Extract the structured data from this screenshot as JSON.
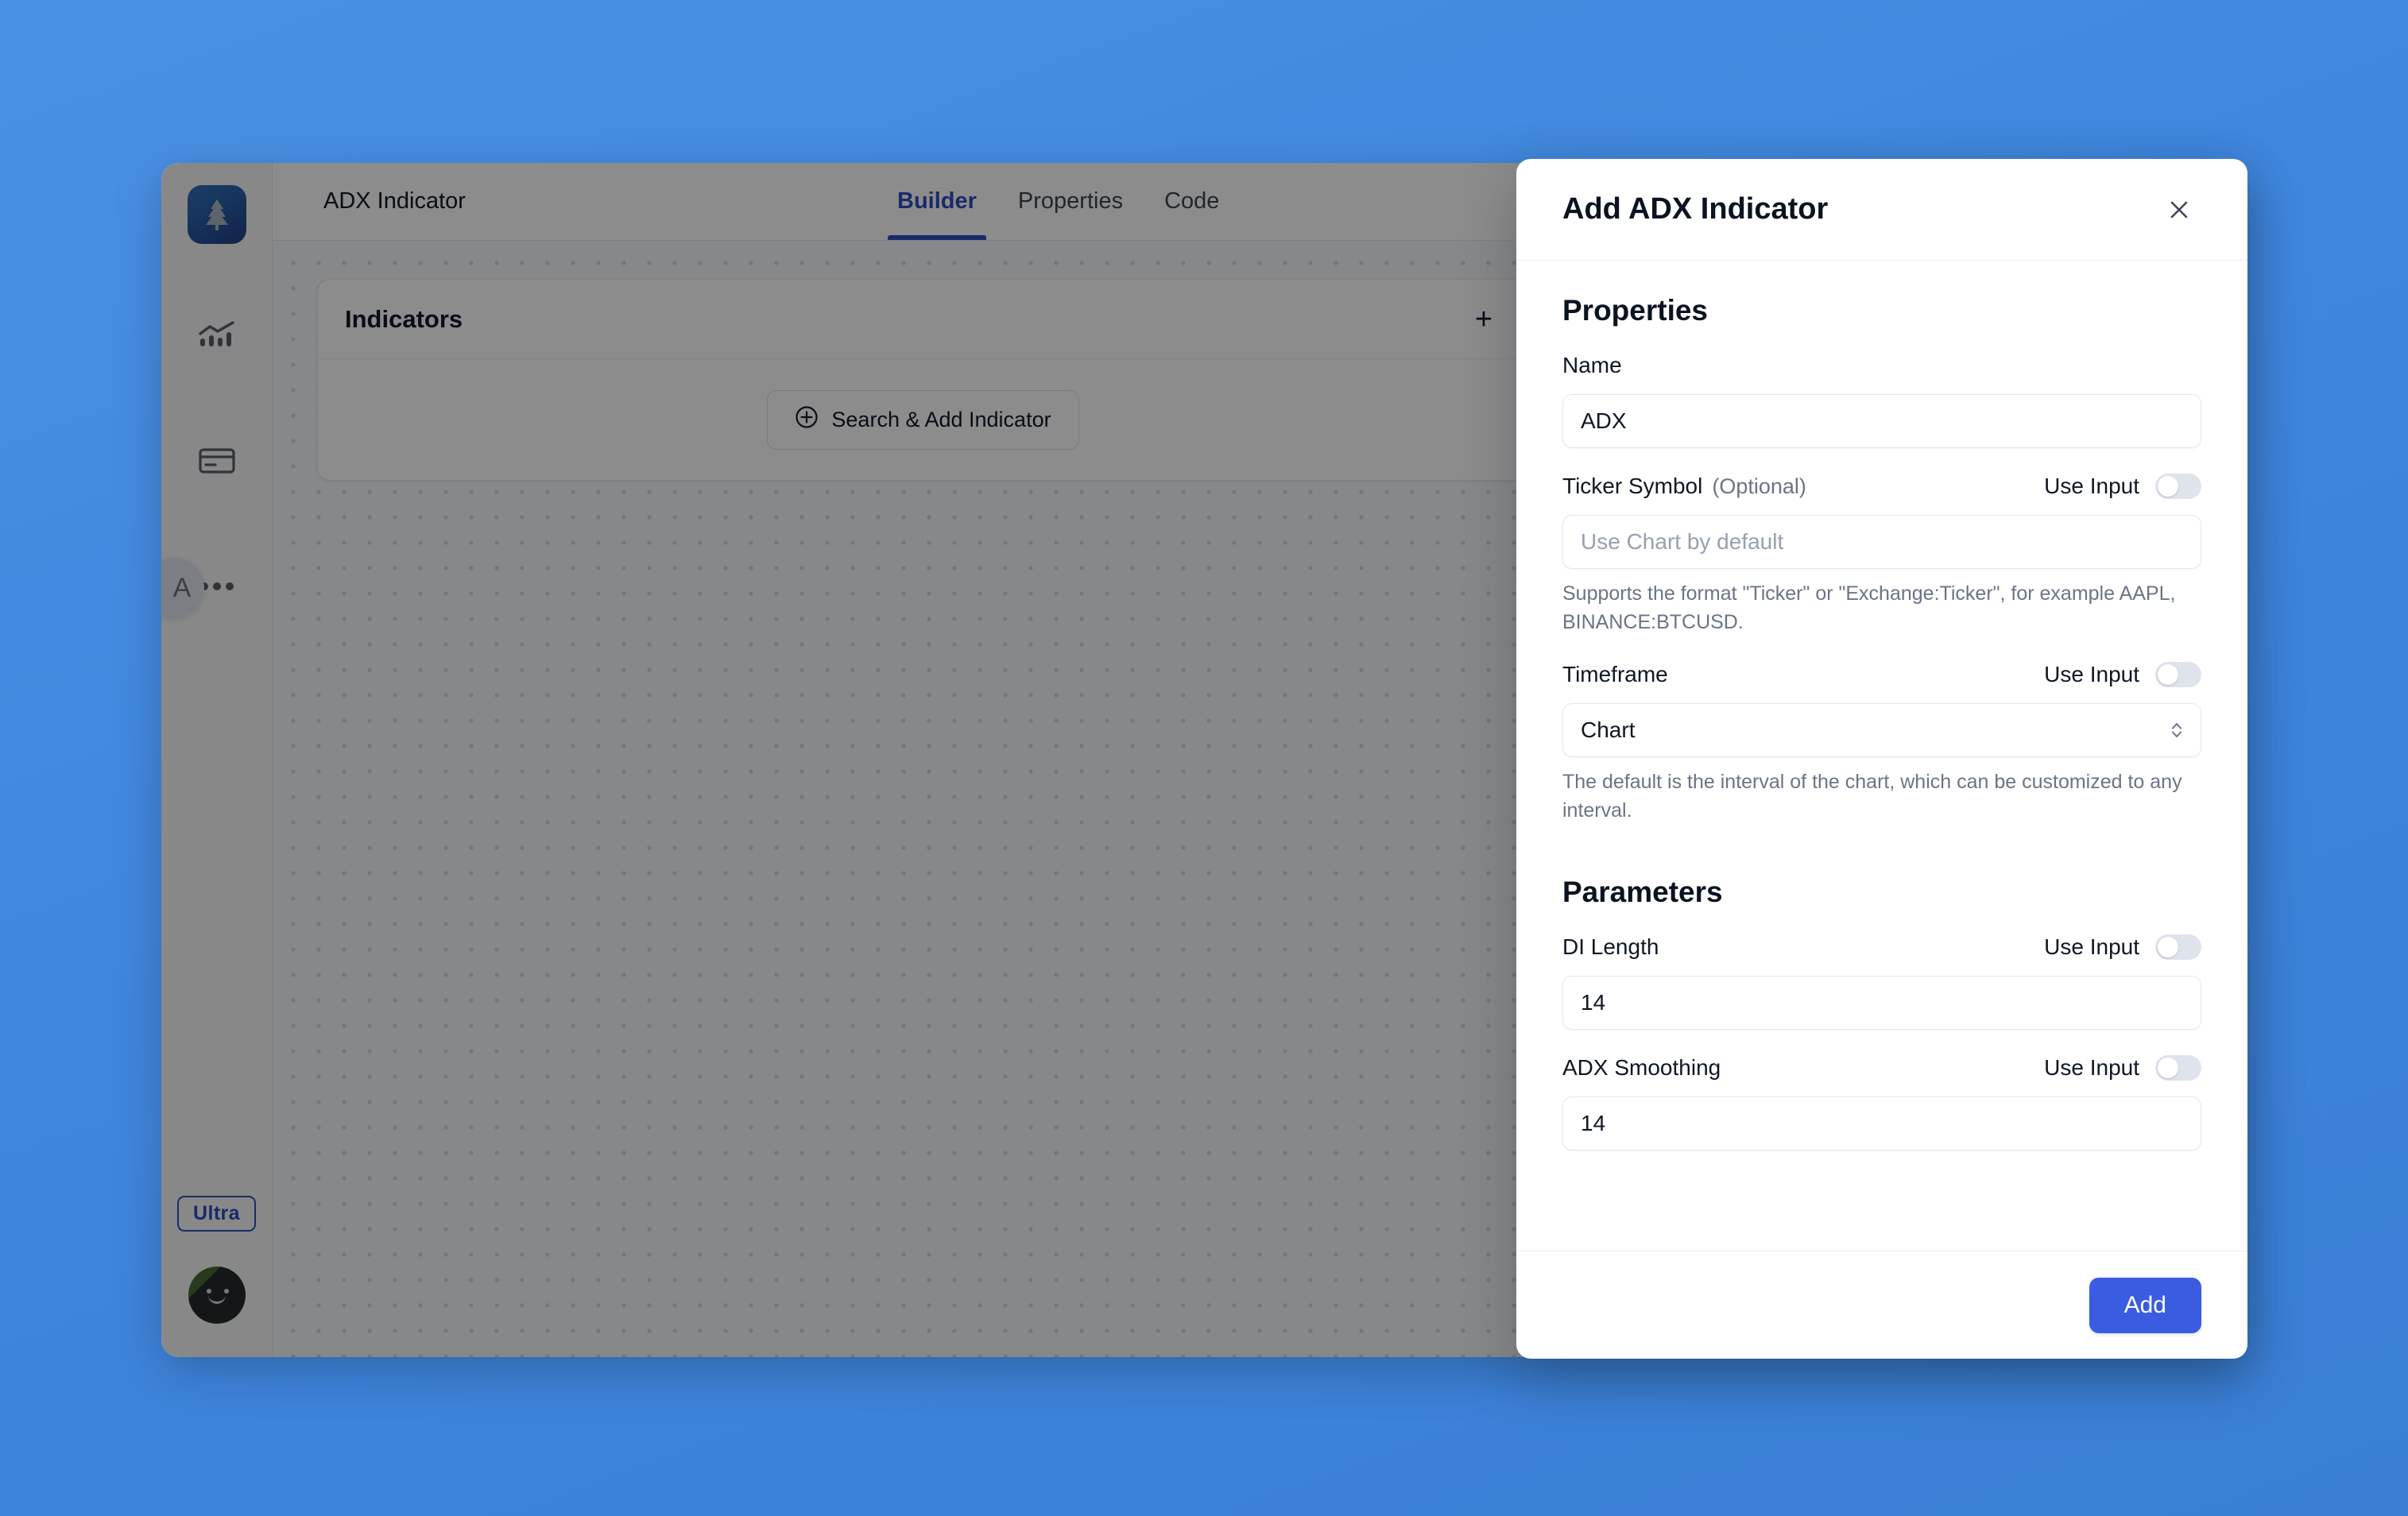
{
  "app": {
    "document_title": "ADX Indicator",
    "tabs": [
      {
        "label": "Builder",
        "active": true
      },
      {
        "label": "Properties",
        "active": false
      },
      {
        "label": "Code",
        "active": false
      }
    ],
    "rail": {
      "logo_icon": "pine-tree-logo-icon",
      "items": [
        {
          "icon": "chart-bars-icon"
        },
        {
          "icon": "credit-card-icon"
        },
        {
          "icon": "ellipsis-icon"
        }
      ],
      "plan_badge": "Ultra",
      "avatar_label": "",
      "side_badge_letter": "A"
    },
    "indicators_card": {
      "title": "Indicators",
      "add_icon": "+",
      "empty_button": "Search & Add Indicator",
      "empty_button_icon": "plus-circle-icon"
    }
  },
  "modal": {
    "title": "Add ADX Indicator",
    "close_icon": "close-icon",
    "sections": {
      "properties_title": "Properties",
      "parameters_title": "Parameters"
    },
    "fields": {
      "name": {
        "label": "Name",
        "value": "ADX",
        "placeholder": ""
      },
      "ticker_symbol": {
        "label": "Ticker Symbol",
        "optional": "(Optional)",
        "use_input_label": "Use Input",
        "use_input_state": "off",
        "value": "",
        "placeholder": "Use Chart by default",
        "hint": "Supports the format \"Ticker\" or \"Exchange:Ticker\", for example AAPL, BINANCE:BTCUSD."
      },
      "timeframe": {
        "label": "Timeframe",
        "use_input_label": "Use Input",
        "use_input_state": "off",
        "selected": "Chart",
        "hint": "The default is the interval of the chart, which can be customized to any interval."
      },
      "di_length": {
        "label": "DI Length",
        "use_input_label": "Use Input",
        "use_input_state": "off",
        "value": "14"
      },
      "adx_smoothing": {
        "label": "ADX Smoothing",
        "use_input_label": "Use Input",
        "use_input_state": "off",
        "value": "14"
      }
    },
    "footer": {
      "add_label": "Add"
    }
  },
  "colors": {
    "accent": "#2f4dc0",
    "primary_button": "#3a5ce0",
    "desktop": "#4a90e2"
  }
}
